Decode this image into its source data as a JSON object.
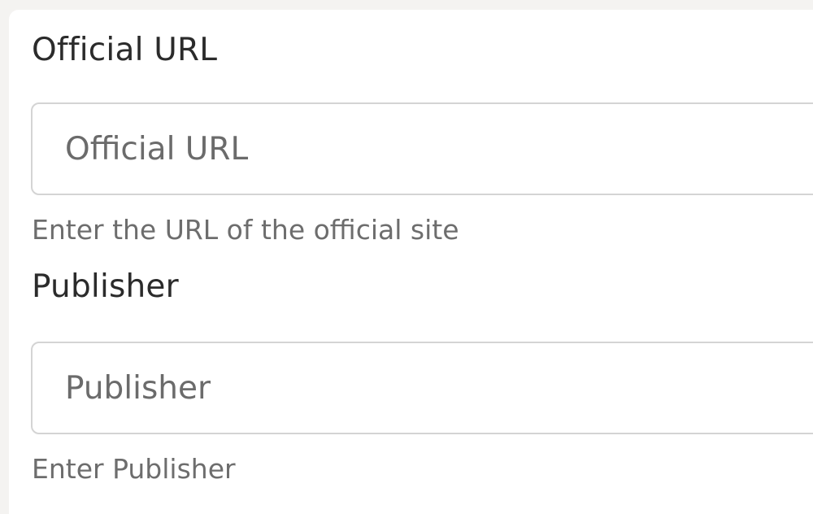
{
  "form": {
    "official_url": {
      "label": "Official URL",
      "placeholder": "Official URL",
      "value": "",
      "help": "Enter the URL of the official site"
    },
    "publisher": {
      "label": "Publisher",
      "placeholder": "Publisher",
      "value": "",
      "help": "Enter Publisher"
    }
  },
  "colors": {
    "page_background": "#f4f3f1",
    "panel_background": "#ffffff",
    "label_text": "#2b2b2b",
    "help_text": "#6d6d6d",
    "input_border": "#d4d4d4"
  }
}
